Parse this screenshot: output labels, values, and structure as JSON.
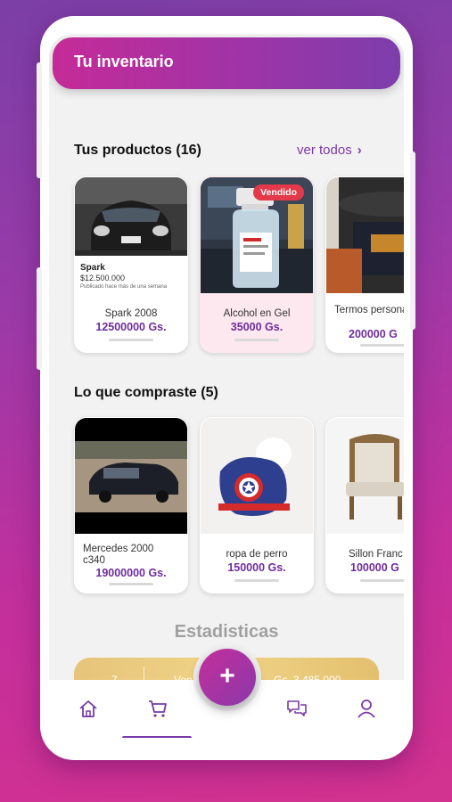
{
  "app": {
    "header_title": "Tu inventario"
  },
  "products": {
    "title": "Tus productos (16)",
    "see_all": "ver todos",
    "items": [
      {
        "name": "Spark 2008",
        "price": "12500000 Gs.",
        "photo_caption": {
          "title": "Spark",
          "price": "$12.500.000",
          "published": "Publicado hace más de una semana"
        }
      },
      {
        "name": "Alcohol en Gel",
        "price": "35000 Gs.",
        "badge": "Vendido"
      },
      {
        "name": "Termos personalizado",
        "price": "200000 G"
      }
    ]
  },
  "purchases": {
    "title": "Lo que compraste (5)",
    "items": [
      {
        "name": "Mercedes 2000 c340",
        "price": "19000000 Gs."
      },
      {
        "name": "ropa de perro",
        "price": "150000 Gs."
      },
      {
        "name": "Sillon Franc",
        "price": "100000 G"
      }
    ]
  },
  "stats": {
    "title": "Estadisticas",
    "count": "7",
    "label": "Ven",
    "amount": "Gs. 3.485.000"
  },
  "fab": {
    "label": "+"
  },
  "nav": {
    "items": [
      "home-icon",
      "cart-icon",
      "chat-icon",
      "user-icon"
    ],
    "active": "cart-icon"
  },
  "colors": {
    "accent": "#7a3aa8",
    "brand_pink": "#c42f9c",
    "sold_badge": "#e23a4a",
    "stats_gold": "#e6c57a"
  }
}
